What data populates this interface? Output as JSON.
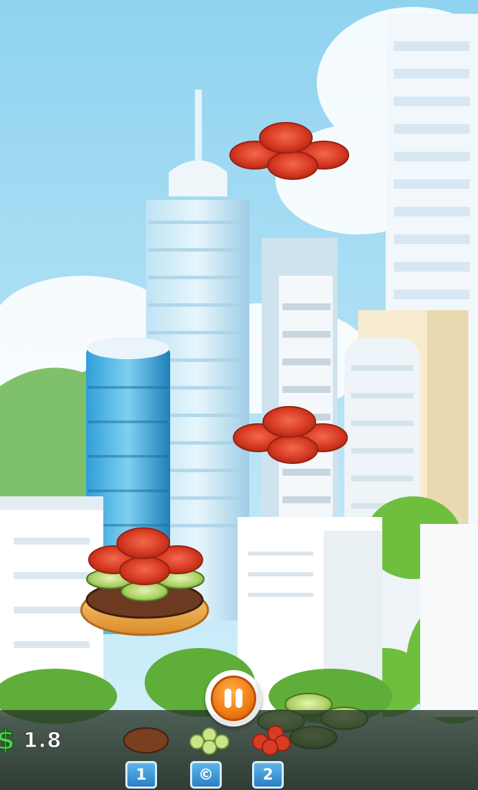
{
  "hud": {
    "currency_symbol": "$",
    "money": "1.8",
    "pause_icon": "pause-icon"
  },
  "ingredient_buttons": [
    {
      "name": "patty",
      "label": "1"
    },
    {
      "name": "pickles",
      "label": "©"
    },
    {
      "name": "tomatoes",
      "label": "2"
    }
  ],
  "colors": {
    "sky": "#bfe6f5",
    "money_green": "#4fd04a",
    "pause_orange": "#f07a12",
    "button_blue": "#2a7fc4",
    "tomato": "#d93b25",
    "pickle": "#a7cf5e",
    "bun": "#f2b04a",
    "patty": "#6b3a20"
  }
}
